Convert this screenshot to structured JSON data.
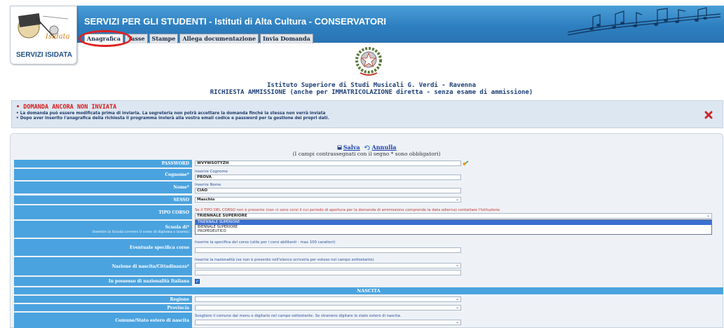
{
  "header": {
    "title": "SERVIZI PER GLI STUDENTI - Istituti di Alta Cultura - CONSERVATORI",
    "logo_caption": "SERVIZI ISIDATA",
    "logo_text": "Isidata"
  },
  "tabs": [
    {
      "label": "Anagrafica",
      "active": true
    },
    {
      "label": "Tasse"
    },
    {
      "label": "Stampe"
    },
    {
      "label": "Allega documentazione"
    },
    {
      "label": "Invia Domanda"
    }
  ],
  "institution": {
    "name": "Istituto Superiore di Studi Musicali G. Verdi - Ravenna",
    "request_title": "RICHIESTA AMMISSIONE (anche per IMMATRICOLAZIONE diretta - senza esame di ammissione)"
  },
  "notice": {
    "status": "DOMANDA ANCORA NON INVIATA",
    "lines": [
      "La domanda può essere modificata prima di inviarla. La segreteria non potrà accettare la domanda finché la stessa non verrà inviata",
      "Dopo aver inserito l'anagrafica della richiesta il programma invierà alla vostra email codice e password per la gestione dei propri dati."
    ]
  },
  "actions": {
    "save": "Salva",
    "cancel": "Annulla",
    "required_note": "(I campi contrassegnati con il segno * sono obbligatori)"
  },
  "form": {
    "password": {
      "label": "PASSWORD",
      "value": "WVYWSOTYZH"
    },
    "cognome": {
      "label": "Cognome*",
      "hint": "Inserire Cognome",
      "value": "PROVA"
    },
    "nome": {
      "label": "Nome*",
      "hint": "Inserire Nome",
      "value": "CIAO"
    },
    "sesso": {
      "label": "SESSO",
      "value": "Maschio"
    },
    "tipo_corso": {
      "label": "TIPO CORSO",
      "hint": "Se il TIPO DEL CORSO non è presente (non ci sono corsi il cui periodo di apertura per la domanda di ammissione comprende la data odierna) contattare l'Istituzione",
      "value": "TRIENNALE SUPERIORE",
      "options": [
        "TRIENNALE SUPERIORE",
        "BIENNALE SUPERIORE",
        "PROPEDEUTICO"
      ]
    },
    "scuola": {
      "label": "Scuola di*",
      "sub": "Inserire la Scuola (ovvero il corso di diploma o laurea)"
    },
    "specifica": {
      "label": "Eventuale specifica corso",
      "hint": "Inserire la specifica del corso (utile per i corsi abilitanti - max 100 caratteri)"
    },
    "nazione": {
      "label": "Nazione di nascita/Cittadinanza*",
      "hint": "Inserire la nazionalità (se non è presente nell'elenco scriverla per esteso nel campo sottostante)"
    },
    "nazionalita_italiana": {
      "label": "In possesso di nazionalità Italiana",
      "checked": true
    },
    "nascita_header": "NASCITA",
    "regione": {
      "label": "Regione"
    },
    "provincia": {
      "label": "Provincia"
    },
    "comune": {
      "label": "Comune/Stato estero di nascita",
      "hint": "Scegliere il comune dal menu o digitarlo nel campo sottostante. Se straniero digitare lo stato estero di nascita."
    }
  },
  "colors": {
    "header_blue": "#2e7fc0",
    "label_blue": "#4aa3df",
    "status_red": "#d81b1b",
    "annotation_red": "#e02020"
  },
  "icons": [
    "save-icon",
    "cancel-icon",
    "key-icon",
    "close-icon",
    "italian-emblem-icon"
  ]
}
